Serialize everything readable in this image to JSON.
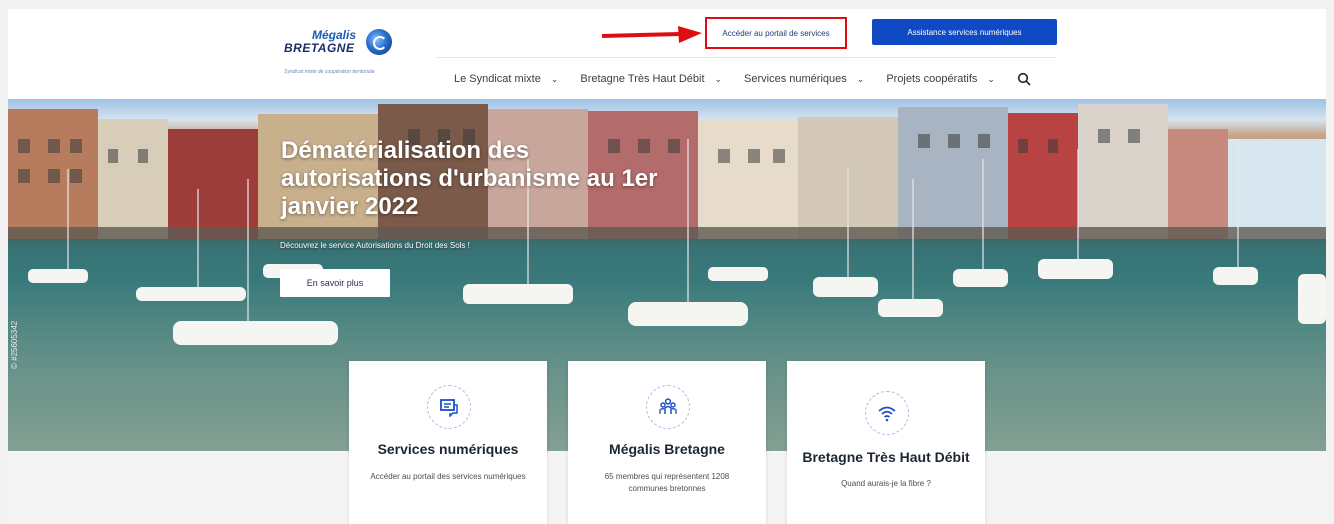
{
  "logo": {
    "line1": "Mégalis",
    "line2": "BRETAGNE",
    "subtitle": "Syndicat mixte de coopération territoriale"
  },
  "header": {
    "portal_link": "Accéder au portail de services",
    "assistance_button": "Assistance services numériques",
    "nav": [
      {
        "label": "Le Syndicat mixte"
      },
      {
        "label": "Bretagne Très Haut Débit"
      },
      {
        "label": "Services numériques"
      },
      {
        "label": "Projets coopératifs"
      }
    ]
  },
  "hero": {
    "title": "Dématérialisation des autorisations d'urbanisme au 1er janvier 2022",
    "subtitle": "Découvrez le service Autorisations du Droit des Sols !",
    "cta": "En savoir plus",
    "credit": "© #25605342"
  },
  "cards": [
    {
      "icon": "chat-icon",
      "title": "Services numériques",
      "description": "Accéder au portail des services numériques"
    },
    {
      "icon": "people-icon",
      "title": "Mégalis Bretagne",
      "description": "65 membres qui représentent 1208 communes bretonnes"
    },
    {
      "icon": "wifi-icon",
      "title": "Bretagne Très Haut Débit",
      "description": "Quand aurais-je la fibre ?"
    }
  ],
  "colors": {
    "accent": "#0f49c4",
    "highlight_border": "#e00d10",
    "icon_blue": "#1a4fc7"
  }
}
